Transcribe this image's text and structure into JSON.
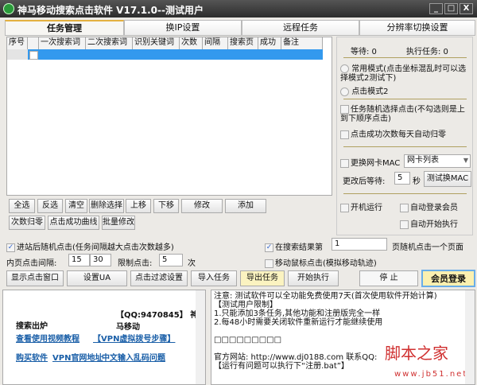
{
  "window": {
    "title": "神马移动搜索点击软件 V17.1.0--测试用户",
    "min": "_",
    "max": "□",
    "close": "X"
  },
  "tabs": [
    "任务管理",
    "换IP设置",
    "远程任务",
    "分辨率切换设置"
  ],
  "table": {
    "columns": [
      "序号",
      "",
      "一次搜索词",
      "二次搜索词",
      "识别关键词",
      "次数",
      "间隔",
      "搜索页",
      "成功",
      "备注"
    ]
  },
  "status": {
    "waiting": "等待: 0",
    "running": "执行任务: 0"
  },
  "modes": {
    "mode1": "常用模式(点击坐标混乱时可以选择模式2测试下)",
    "mode2": "点击模式2"
  },
  "options": {
    "random_select": "任务随机选择点击(不勾选则是上到下顺序点击)",
    "reset_daily": "点击成功次数每天自动归零",
    "change_mac": "更换网卡MAC",
    "nic_select": "网卡列表",
    "wait_after": "更改后等待:",
    "wait_value": "5",
    "seconds": "秒",
    "test_mac": "测试换MAC",
    "startup": "开机运行",
    "auto_login": "自动登录会员",
    "auto_start": "自动开始执行"
  },
  "task_buttons": [
    "全选",
    "反选",
    "清空",
    "删除选择",
    "上移",
    "下移",
    "修改",
    "添加",
    "次数归零",
    "点击成功曲线",
    "批量修改"
  ],
  "click_opts": {
    "random_click": "进站后随机点击(任务间隔越大点击次数越多)",
    "inner_interval": "内页点击间隔:",
    "interval_min": "15",
    "interval_max": "30",
    "limit": "限制点击:",
    "limit_value": "5",
    "times": "次",
    "in_results": "在搜索结果第",
    "page_value": "1",
    "page_suffix": "页随机点击一个页面",
    "mouse_move": "移动鼠标点击(模拟移动轨迹)"
  },
  "actions": [
    "显示点击窗口",
    "设置UA",
    "点击过滤设置",
    "导入任务",
    "导出任务",
    "开始执行",
    "停 止",
    "会员登录"
  ],
  "info": {
    "qq": "【QQ:9470845】 神马移动",
    "subtitle": "搜索出炉",
    "links": [
      "查看使用视频教程",
      "【VPN虚拟拨号步骤】",
      "购买软件",
      "VPN官网地址",
      "中文输入乱码问题"
    ]
  },
  "notice": [
    "注意: 测试软件可以全功能免费使用7天(首次使用软件开始计算)",
    "【测试用户限制】",
    "1.只能添加3条任务,其他功能和注册版完全一样",
    "2.每48小时需要关闭软件重新运行才能继续使用",
    "",
    "□□□□□□□□□",
    "",
    "官方网站: http://www.dj0188.com 联系QQ:",
    "【运行有问题可以执行下“注册.bat”】"
  ],
  "watermark": {
    "text": "脚本之家",
    "url": "www.jb51.net"
  }
}
